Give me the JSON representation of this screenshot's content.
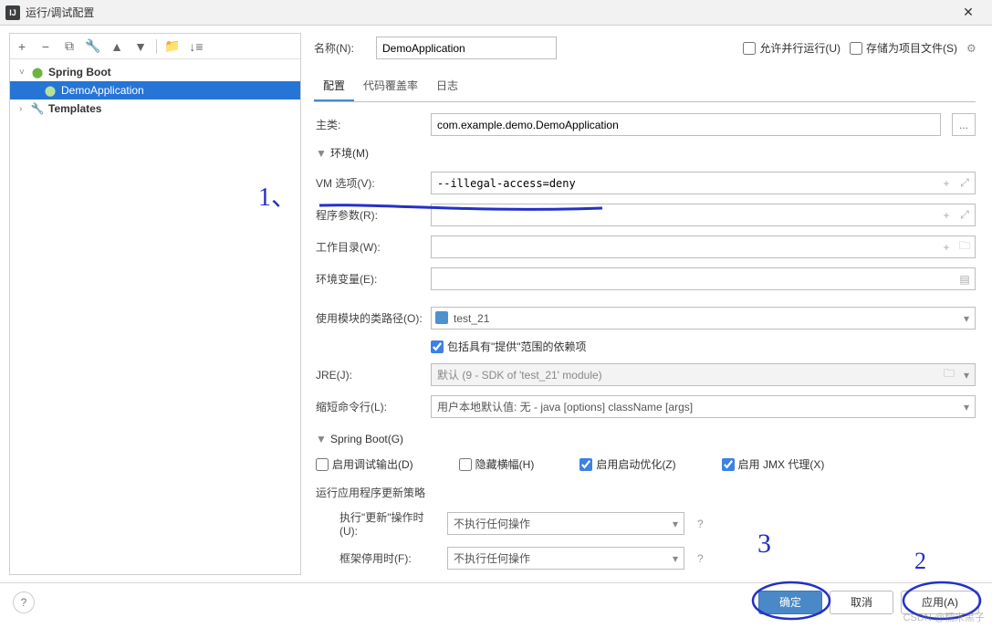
{
  "window": {
    "title": "运行/调试配置",
    "close": "✕"
  },
  "toolbar_icons": {
    "add": "+",
    "remove": "−",
    "copy": "⧉",
    "wrench": "🔧",
    "up": "▲",
    "down": "▼",
    "folder": "📁",
    "sort": "↓≡"
  },
  "tree": {
    "spring_boot": {
      "label": "Spring Boot",
      "chev": "˅"
    },
    "demo_app": {
      "label": "DemoApplication"
    },
    "templates": {
      "label": "Templates",
      "chev": "›"
    }
  },
  "header": {
    "name_label": "名称(N):",
    "name_value": "DemoApplication",
    "allow_parallel": "允许并行运行(U)",
    "store_project": "存储为项目文件(S)"
  },
  "tabs": {
    "config": "配置",
    "coverage": "代码覆盖率",
    "logs": "日志"
  },
  "form": {
    "main_class_lbl": "主类:",
    "main_class_val": "com.example.demo.DemoApplication",
    "browse": "...",
    "env_section": "环境(M)",
    "vm_lbl": "VM 选项(V):",
    "vm_val": "--illegal-access=deny",
    "args_lbl": "程序参数(R):",
    "args_val": "",
    "workdir_lbl": "工作目录(W):",
    "workdir_val": "",
    "envvars_lbl": "环境变量(E):",
    "envvars_val": "",
    "classpath_lbl": "使用模块的类路径(O):",
    "classpath_val": "test_21",
    "include_provided": "包括具有\"提供\"范围的依赖项",
    "jre_lbl": "JRE(J):",
    "jre_val": "默认 (9 - SDK of 'test_21' module)",
    "shorten_lbl": "缩短命令行(L):",
    "shorten_val": "用户本地默认值: 无 - java [options] className [args]",
    "springboot_section": "Spring Boot(G)",
    "cb_debug": "启用调试输出(D)",
    "cb_hidebanner": "隐藏横幅(H)",
    "cb_startupopt": "启用启动优化(Z)",
    "cb_jmx": "启用 JMX 代理(X)",
    "policy_lbl": "运行应用程序更新策略",
    "on_update_lbl": "执行\"更新\"操作时(U):",
    "on_update_val": "不执行任何操作",
    "on_deact_lbl": "框架停用时(F):",
    "on_deact_val": "不执行任何操作"
  },
  "footer": {
    "help": "?",
    "ok": "确定",
    "cancel": "取消",
    "apply": "应用(A)"
  },
  "annot": {
    "n1": "1、",
    "n2": "2",
    "n3": "3"
  },
  "watermark": "CSDN @糯米黑子"
}
